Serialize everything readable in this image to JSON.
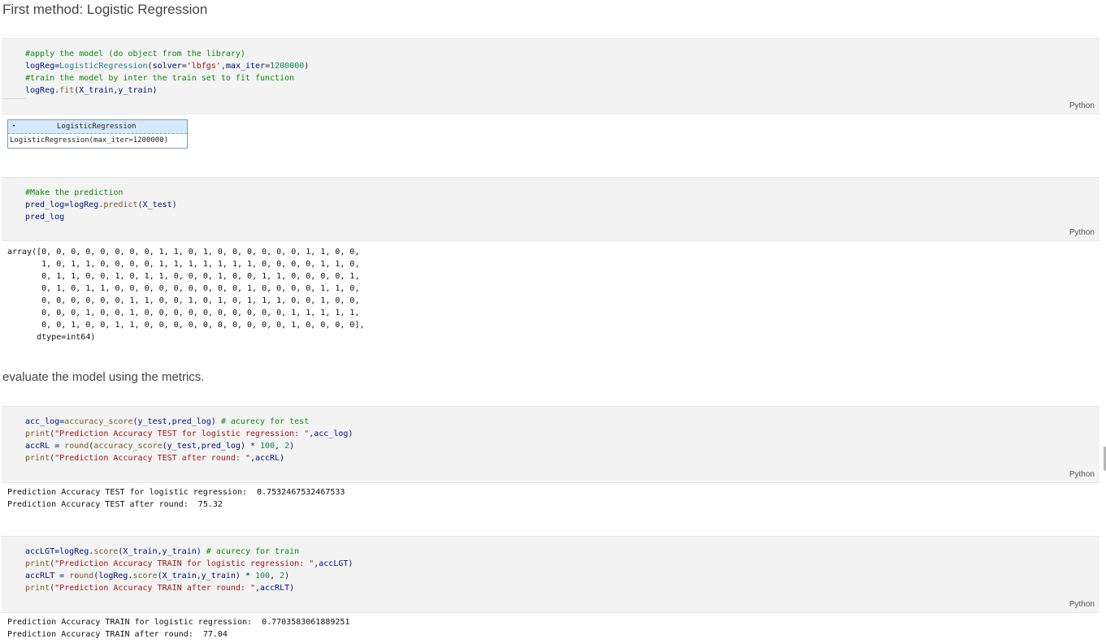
{
  "heading": "First method: Logistic Regression",
  "paragraph": "evaluate the model using the metrics.",
  "lang_label": "Python",
  "cell1": {
    "l1": "#apply the model (do object from the library)",
    "l2a": "logReg=",
    "l2b": "LogisticRegression",
    "l2c": "(",
    "l2d": "solver",
    "l2e": "=",
    "l2f": "'lbfgs'",
    "l2g": ",",
    "l2h": "max_iter",
    "l2i": "=",
    "l2j": "1200000",
    "l2k": ")",
    "l3": "#train the model by inter the train set to fit function",
    "l4a": "logReg",
    "l4b": ".",
    "l4c": "fit",
    "l4d": "(X_train,y_train)"
  },
  "estimator": {
    "arrow": "▾",
    "title": "LogisticRegression",
    "body": "LogisticRegression(max_iter=1200000)"
  },
  "cell2": {
    "l1": "#Make the prediction",
    "l2a": "pred_log=logReg.",
    "l2b": "predict",
    "l2c": "(X_test)",
    "l3": "pred_log"
  },
  "array_output": [
    "array([0, 0, 0, 0, 0, 0, 0, 0, 1, 1, 0, 1, 0, 0, 0, 0, 0, 0, 1, 1, 0, 0,",
    "       1, 0, 1, 1, 0, 0, 0, 0, 1, 1, 1, 1, 1, 1, 1, 0, 0, 0, 0, 1, 1, 0,",
    "       0, 1, 1, 0, 0, 1, 0, 1, 1, 0, 0, 0, 1, 0, 0, 1, 1, 0, 0, 0, 0, 1,",
    "       0, 1, 0, 1, 1, 0, 0, 0, 0, 0, 0, 0, 0, 0, 1, 0, 0, 0, 0, 1, 1, 0,",
    "       0, 0, 0, 0, 0, 0, 1, 1, 0, 0, 1, 0, 1, 0, 1, 1, 1, 0, 0, 1, 0, 0,",
    "       0, 0, 0, 1, 0, 0, 1, 0, 0, 0, 0, 0, 0, 0, 0, 0, 0, 1, 1, 1, 1, 1,",
    "       0, 0, 1, 0, 0, 1, 1, 0, 0, 0, 0, 0, 0, 0, 0, 0, 0, 1, 0, 0, 0, 0],",
    "      dtype=int64)"
  ],
  "cell3": {
    "l1a": "acc_log=",
    "l1b": "accuracy_score",
    "l1c": "(y_test,pred_log) ",
    "l1d": "# acurecy for test",
    "l2a": "print",
    "l2b": "(",
    "l2c": "\"Prediction Accuracy TEST for logistic regression: \"",
    "l2d": ",acc_log)",
    "l3a": "accRL = ",
    "l3b": "round",
    "l3c": "(",
    "l3d": "accuracy_score",
    "l3e": "(y_test,pred_log) * ",
    "l3f": "100",
    "l3g": ", ",
    "l3h": "2",
    "l3i": ")",
    "l4a": "print",
    "l4b": "(",
    "l4c": "\"Prediction Accuracy TEST after round: \"",
    "l4d": ",accRL)"
  },
  "out3": [
    "Prediction Accuracy TEST for logistic regression:  0.7532467532467533",
    "Prediction Accuracy TEST after round:  75.32"
  ],
  "cell4": {
    "l1a": "accLGT=logReg.",
    "l1b": "score",
    "l1c": "(X_train,y_train) ",
    "l1d": "# acurecy for train",
    "l2a": "print",
    "l2b": "(",
    "l2c": "\"Prediction Accuracy TRAIN for logistic regression: \"",
    "l2d": ",accLGT)",
    "l3a": "accRLT = ",
    "l3b": "round",
    "l3c": "(logReg.",
    "l3d": "score",
    "l3e": "(X_train,y_train) * ",
    "l3f": "100",
    "l3g": ", ",
    "l3h": "2",
    "l3i": ")",
    "l4a": "print",
    "l4b": "(",
    "l4c": "\"Prediction Accuracy TRAIN after round: \"",
    "l4d": ",accRLT)"
  },
  "out4": [
    "Prediction Accuracy TRAIN for logistic regression:  0.7703583061889251",
    "Prediction Accuracy TRAIN after round:  77.04"
  ]
}
